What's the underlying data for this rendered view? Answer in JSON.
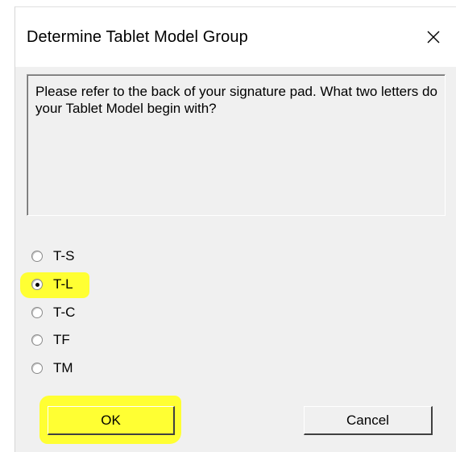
{
  "dialog": {
    "title": "Determine Tablet Model Group",
    "close_icon": "close-icon",
    "message": "Please refer to the back of your signature pad. What two letters do your Tablet Model begin with?",
    "options": [
      {
        "label": "T-S",
        "selected": false
      },
      {
        "label": "T-L",
        "selected": true
      },
      {
        "label": "T-C",
        "selected": false
      },
      {
        "label": "TF",
        "selected": false
      },
      {
        "label": "TM",
        "selected": false
      }
    ],
    "ok_label": "OK",
    "cancel_label": "Cancel"
  },
  "colors": {
    "highlight": "#ffff33",
    "dialog_bg": "#f0f0f0",
    "titlebar_bg": "#ffffff"
  }
}
